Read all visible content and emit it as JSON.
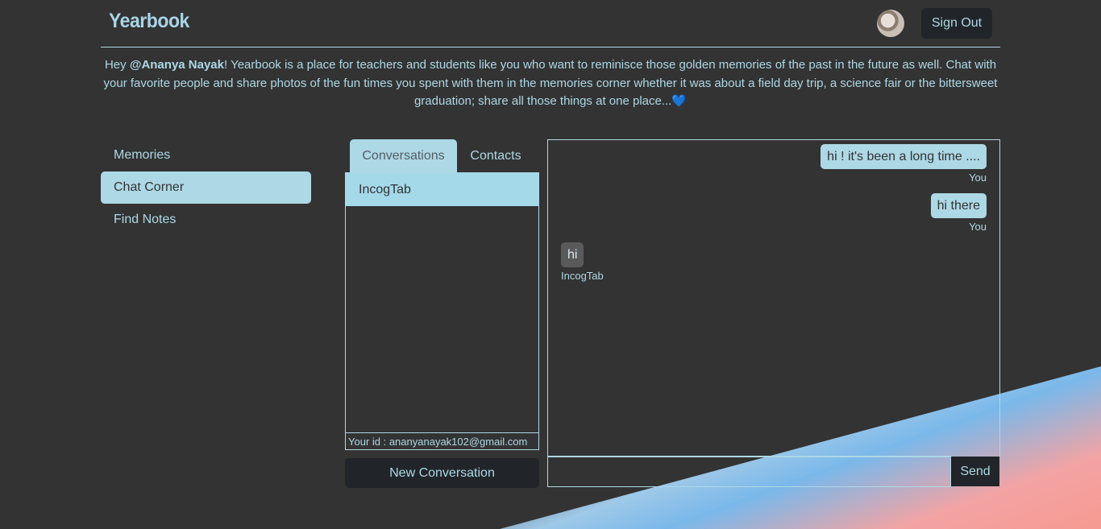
{
  "header": {
    "brand": "Yearbook",
    "sign_out_label": "Sign Out"
  },
  "intro": {
    "prefix": "Hey ",
    "username": "@Ananya Nayak",
    "body": "! Yearbook is a place for teachers and students like you who want to reminisce those golden memories of the past in the future as well. Chat with your favorite people and share photos of the fun times you spent with them in the memories corner whether it was about a field day trip, a science fair or the bittersweet graduation; share all those things at one place...",
    "heart": "💙"
  },
  "sidebar": {
    "items": [
      {
        "label": "Memories",
        "active": false
      },
      {
        "label": "Chat Corner",
        "active": true
      },
      {
        "label": "Find Notes",
        "active": false
      }
    ]
  },
  "tabs": [
    {
      "label": "Conversations",
      "active": true
    },
    {
      "label": "Contacts",
      "active": false
    }
  ],
  "conversations": [
    {
      "name": "IncogTab",
      "selected": true
    }
  ],
  "your_id": "Your id : ananyanayak102@gmail.com",
  "new_conversation_label": "New Conversation",
  "messages": [
    {
      "text": "hi ! it's been a long time ....",
      "sender": "You",
      "mine": true
    },
    {
      "text": "hi there",
      "sender": "You",
      "mine": true
    },
    {
      "text": "hi",
      "sender": "IncogTab",
      "mine": false
    }
  ],
  "composer": {
    "value": "",
    "send_label": "Send"
  },
  "colors": {
    "background": "#333333",
    "accent": "#add8e6",
    "button_dark": "#212529"
  }
}
